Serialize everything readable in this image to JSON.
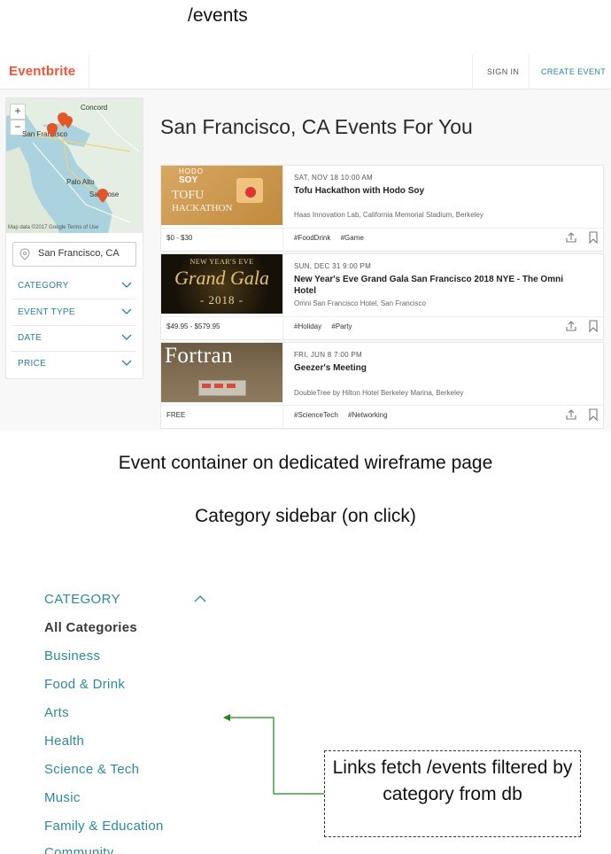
{
  "captions": {
    "route": "/events",
    "event_container": "Event container on dedicated wireframe page",
    "category_sidebar": "Category sidebar (on click)",
    "note": "Links fetch /events filtered by category from db"
  },
  "colors": {
    "brand": "#f05537",
    "link": "#2c7f9e",
    "category": "#2c8a98",
    "arrow": "#1a8a1a"
  },
  "header": {
    "logo": "Eventbrite",
    "sign_in": "SIGN IN",
    "create_event": "CREATE EVENT"
  },
  "map": {
    "labels": {
      "concord": "Concord",
      "san_francisco": "San Francisco",
      "palo_alto": "Palo Alto",
      "san_jose": "San Jose"
    },
    "zoom_in": "+",
    "zoom_out": "−",
    "footer": "Map data ©2017 Google   Terms of Use",
    "icons": [
      "map-pin-icon",
      "location-pin-icon"
    ]
  },
  "location": {
    "value": "San Francisco, CA"
  },
  "filters": [
    "CATEGORY",
    "EVENT TYPE",
    "DATE",
    "PRICE"
  ],
  "page_title": "San Francisco, CA Events For You",
  "events": [
    {
      "date": "SAT, NOV 18 10:00 AM",
      "title": "Tofu Hackathon with Hodo Soy",
      "venue": "Haas Innovation Lab, California Memorial Stadium, Berkeley",
      "price": "$0 - $30",
      "tags": [
        "#FoodDrink",
        "#Game"
      ],
      "thumb_text": [
        "HODO",
        "SOY",
        "TOFU",
        "HACKATHON"
      ]
    },
    {
      "date": "SUN, DEC 31 9:00 PM",
      "title": "New Year's Eve Grand Gala San Francisco 2018 NYE - The Omni Hotel",
      "venue": "Omni San Francisco Hotel, San Francisco",
      "price": "$49.95 - $579.95",
      "tags": [
        "#Holiday",
        "#Party"
      ],
      "thumb_text": [
        "NEW YEAR'S EVE",
        "Grand Gala",
        "- 2018 -"
      ]
    },
    {
      "date": "FRI, JUN 8 7:00 PM",
      "title": "Geezer's Meeting",
      "venue": "DoubleTree by Hilton Hotel Berkeley Marina, Berkeley",
      "price": "FREE",
      "tags": [
        "#ScienceTech",
        "#Networking"
      ],
      "thumb_text": [
        "Fortran"
      ]
    }
  ],
  "category_panel": {
    "heading": "CATEGORY",
    "items": [
      "All Categories",
      "Business",
      "Food & Drink",
      "Arts",
      "Health",
      "Science & Tech",
      "Music",
      "Family & Education",
      "Community"
    ]
  }
}
